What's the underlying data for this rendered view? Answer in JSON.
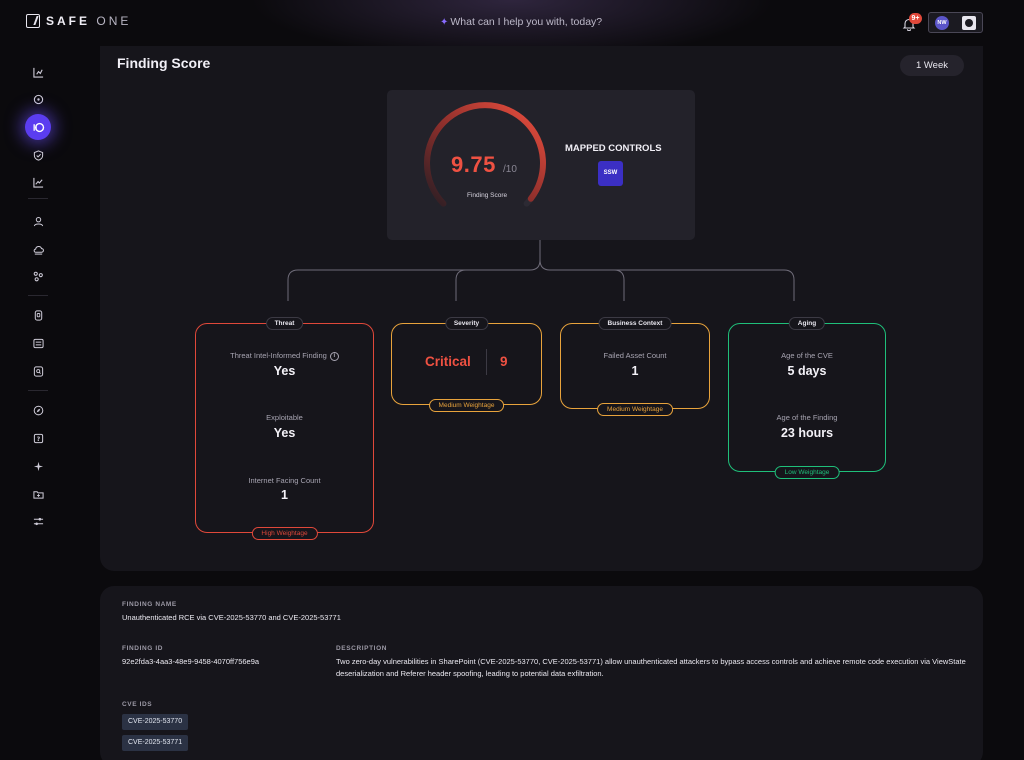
{
  "header": {
    "logo_bold": "SAFE",
    "logo_thin": "ONE",
    "ask_placeholder": "What can I help you with, today?",
    "notification_count": "9+",
    "user_initials": "NW"
  },
  "sidebar": {
    "icons": [
      "chart-icon",
      "target-icon",
      "findings-icon",
      "shield-check-icon",
      "trend-icon",
      "user-icon",
      "cloud-icon",
      "nodes-icon",
      "document-icon",
      "list-icon",
      "search-doc-icon",
      "compass-icon",
      "help-icon",
      "sparkle-icon",
      "folder-icon",
      "sliders-icon"
    ],
    "active": "findings-icon"
  },
  "panel": {
    "title": "Finding Score",
    "range_button": "1 Week",
    "score": "9.75",
    "score_max": "/10",
    "score_fraction": 0.975,
    "score_label": "Finding Score",
    "mapped_controls_title": "MAPPED CONTROLS",
    "mapped_control_badge": "SSW"
  },
  "categories": {
    "threat": {
      "title": "Threat",
      "metric1_label": "Threat Intel-Informed Finding",
      "metric1_value": "Yes",
      "metric2_label": "Exploitable",
      "metric2_value": "Yes",
      "metric3_label": "Internet Facing Count",
      "metric3_value": "1",
      "weightage": "High Weightage",
      "color": "#e0483a"
    },
    "severity": {
      "title": "Severity",
      "level": "Critical",
      "score": "9",
      "weightage": "Medium Weightage",
      "color": "#e8a33c"
    },
    "business": {
      "title": "Business Context",
      "metric_label": "Failed Asset Count",
      "metric_value": "1",
      "weightage": "Medium Weightage",
      "color": "#e8a33c"
    },
    "aging": {
      "title": "Aging",
      "metric1_label": "Age of the CVE",
      "metric1_value": "5 days",
      "metric2_label": "Age of the Finding",
      "metric2_value": "23 hours",
      "weightage": "Low Weightage",
      "color": "#1fbf7a"
    }
  },
  "details": {
    "finding_name_label": "FINDING NAME",
    "finding_name": "Unauthenticated RCE via CVE-2025-53770 and CVE-2025-53771",
    "finding_id_label": "FINDING ID",
    "finding_id": "92e2fda3-4aa3-48e9-9458-4070ff756e9a",
    "description_label": "DESCRIPTION",
    "description": "Two zero-day vulnerabilities in SharePoint (CVE-2025-53770, CVE-2025-53771) allow unauthenticated attackers to bypass access controls and achieve remote code execution via ViewState deserialization and Referer header spoofing, leading to potential data exfiltration.",
    "cve_ids_label": "CVE IDS",
    "cve_ids": [
      "CVE-2025-53770",
      "CVE-2025-53771"
    ]
  }
}
